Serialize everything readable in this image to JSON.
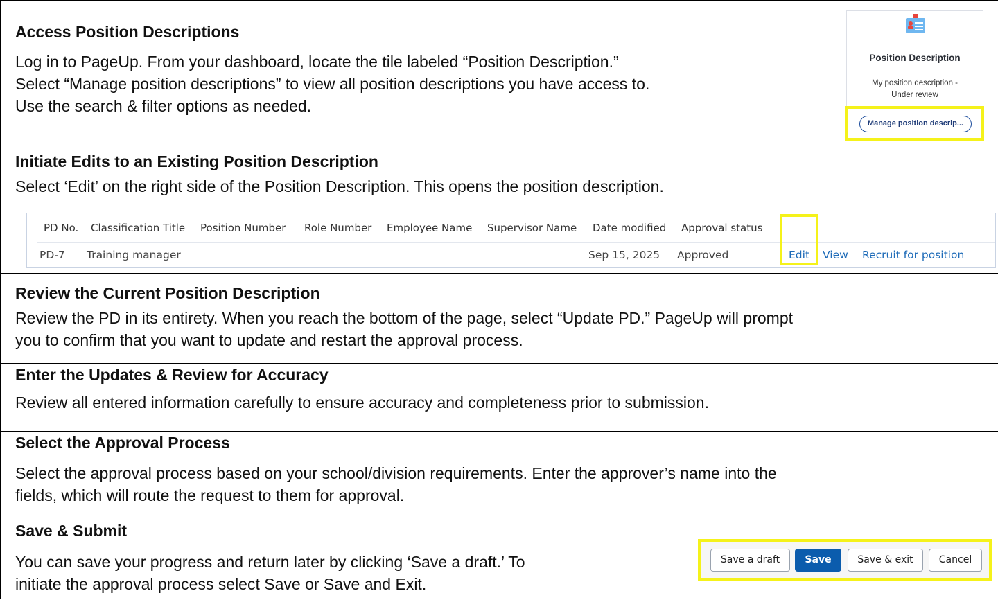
{
  "sections": [
    {
      "heading": "Access Position Descriptions",
      "lines": [
        "Log in to PageUp. From your dashboard, locate the tile labeled “Position Description.”",
        "Select “Manage position descriptions” to view all position descriptions you have access to.",
        "Use the search & filter options as needed."
      ]
    },
    {
      "heading": "Initiate Edits to an Existing Position Description",
      "lines": [
        "Select ‘Edit’ on the right side of the Position Description. This opens the position description."
      ]
    },
    {
      "heading": "Review the Current Position Description",
      "lines": [
        "Review the PD in its entirety. When you reach the bottom of the page, select “Update PD.” PageUp will prompt",
        "you to confirm that you want to update and restart the approval process."
      ]
    },
    {
      "heading": "Enter the Updates & Review for Accuracy",
      "lines": [
        "Review all entered information carefully to ensure accuracy and completeness prior to submission."
      ]
    },
    {
      "heading": "Select the Approval Process",
      "lines": [
        "Select the approval process based on your school/division requirements. Enter the approver’s name into the",
        "fields, which will route the request to them for approval."
      ]
    },
    {
      "heading": "Save & Submit",
      "lines": [
        "You can save your progress and return later by clicking ‘Save a draft.’ To",
        "initiate the approval process select Save or Save and Exit."
      ]
    }
  ],
  "tile": {
    "title": "Position Description",
    "subtitle_line1": "My position description -",
    "subtitle_line2": "Under review",
    "button_label": "Manage position descrip..."
  },
  "table": {
    "headers": [
      "PD No.",
      "Classification Title",
      "Position Number",
      "Role Number",
      "Employee Name",
      "Supervisor Name",
      "Date modified",
      "Approval status"
    ],
    "row": {
      "pd_no": "PD-7",
      "classification_title": "Training manager",
      "date_modified": "Sep 15, 2025",
      "approval_status": "Approved"
    },
    "actions": [
      "Edit",
      "View",
      "Recruit for position"
    ]
  },
  "buttons": {
    "save_draft": "Save a draft",
    "save": "Save",
    "save_exit": "Save & exit",
    "cancel": "Cancel"
  },
  "colors": {
    "highlight": "#f5f21a",
    "link": "#1e6bb8",
    "primary_button": "#0b5cad"
  }
}
